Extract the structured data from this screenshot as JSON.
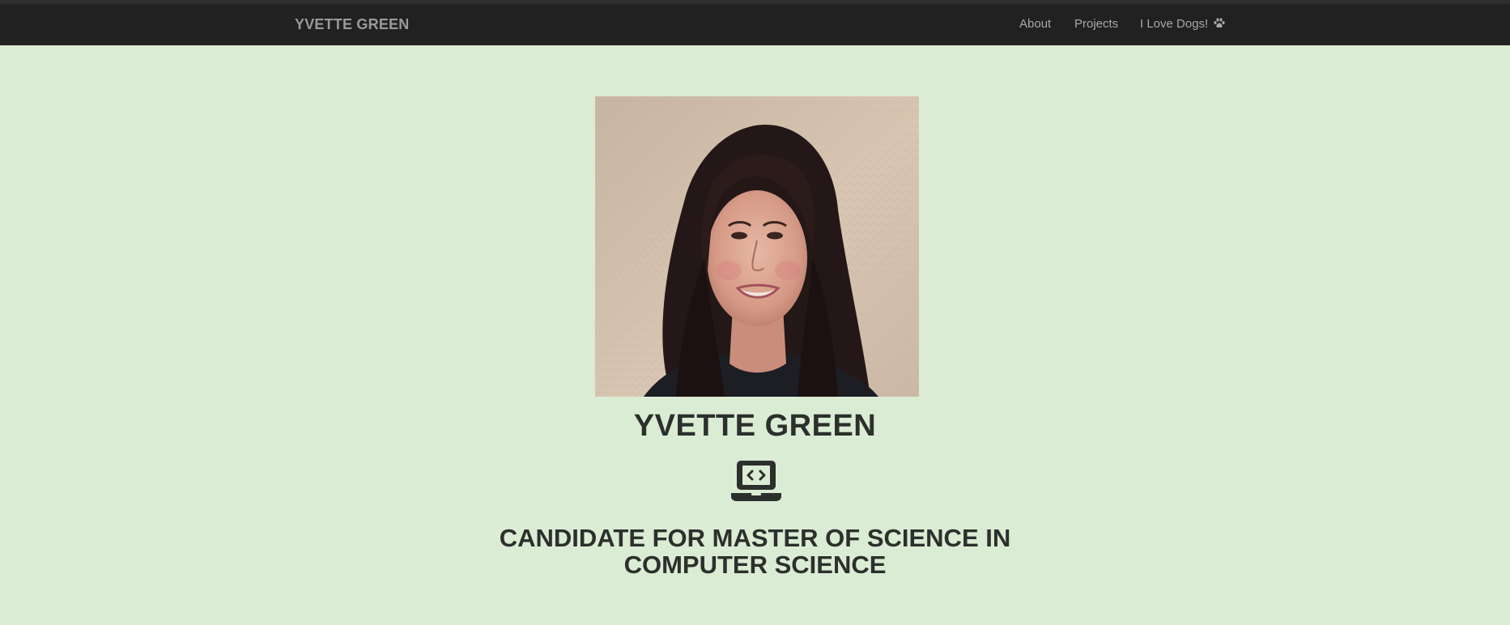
{
  "navbar": {
    "brand": "YVETTE GREEN",
    "links": [
      {
        "label": "About"
      },
      {
        "label": "Projects"
      },
      {
        "label": "I Love Dogs!",
        "icon": "paw-icon"
      }
    ]
  },
  "hero": {
    "photo_icon": "portrait-photo",
    "name": "YVETTE GREEN",
    "role_icon": "laptop-code-icon",
    "subtitle_line1": "CANDIDATE FOR MASTER OF SCIENCE IN",
    "subtitle_line2": "COMPUTER SCIENCE"
  },
  "colors": {
    "page_background": "#dbecd4",
    "navbar_background": "#212121",
    "brand_text": "#9a9a9a",
    "nav_text": "#a8a8a8",
    "heading_text": "#2c302c"
  }
}
